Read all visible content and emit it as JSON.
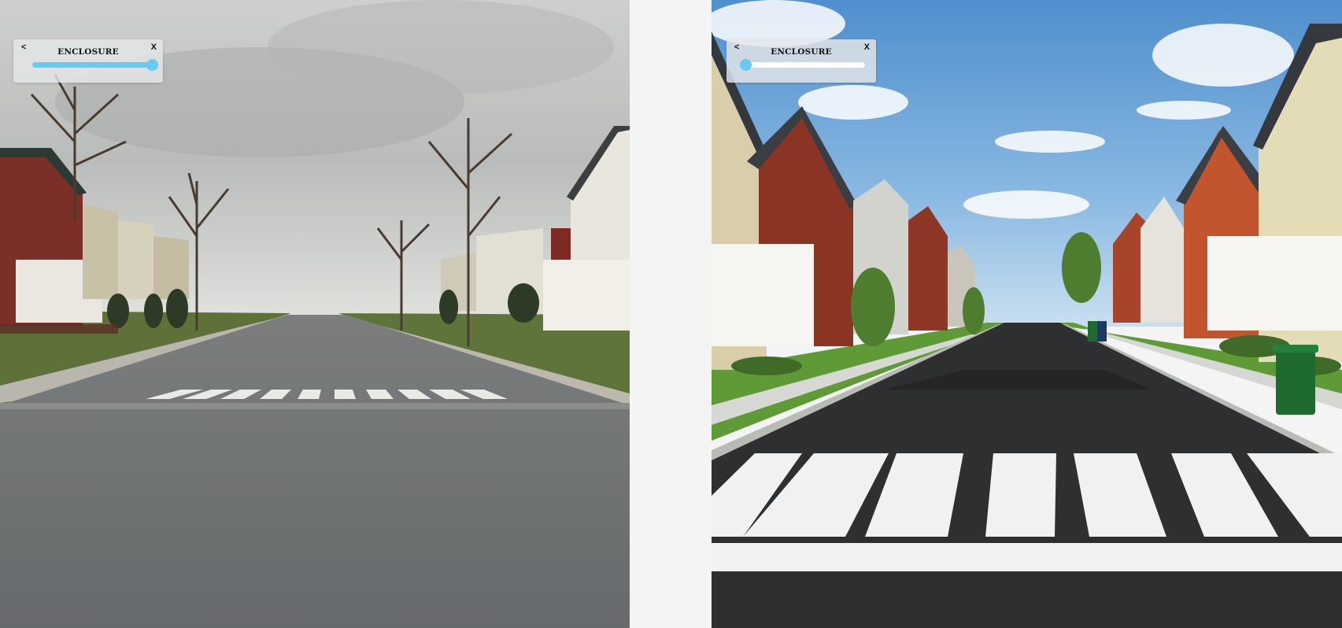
{
  "panels": [
    {
      "id": "left",
      "widget": {
        "back_label": "<",
        "title": "ENCLOSURE",
        "close_label": "X",
        "level": 1.0
      }
    },
    {
      "id": "right",
      "widget": {
        "back_label": "<",
        "title": "ENCLOSURE",
        "close_label": "X",
        "level": 0.0
      }
    }
  ],
  "colors": {
    "slider_accent": "#67cbef",
    "widget_bg": "#e4e6e9",
    "page_bg": "#f4f4f4"
  }
}
